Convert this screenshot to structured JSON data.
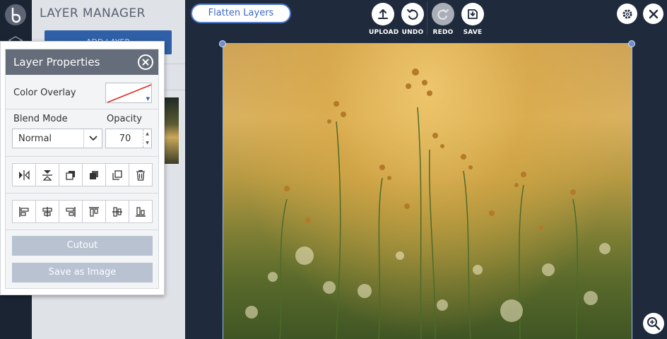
{
  "layer_manager": {
    "title": "LAYER MANAGER",
    "add_layer_label": "ADD LAYER"
  },
  "toolbar": {
    "flatten_label": "Flatten Layers",
    "upload_label": "UPLOAD",
    "undo_label": "UNDO",
    "redo_label": "REDO",
    "save_label": "SAVE"
  },
  "layer_properties": {
    "title": "Layer Properties",
    "color_overlay_label": "Color Overlay",
    "blend_mode_label": "Blend Mode",
    "blend_mode_value": "Normal",
    "opacity_label": "Opacity",
    "opacity_value": "70",
    "cutout_label": "Cutout",
    "save_as_image_label": "Save as Image"
  },
  "colors": {
    "accent": "#2f5fa6",
    "dialog_header": "#656c7a",
    "background": "#1f2a3c"
  }
}
